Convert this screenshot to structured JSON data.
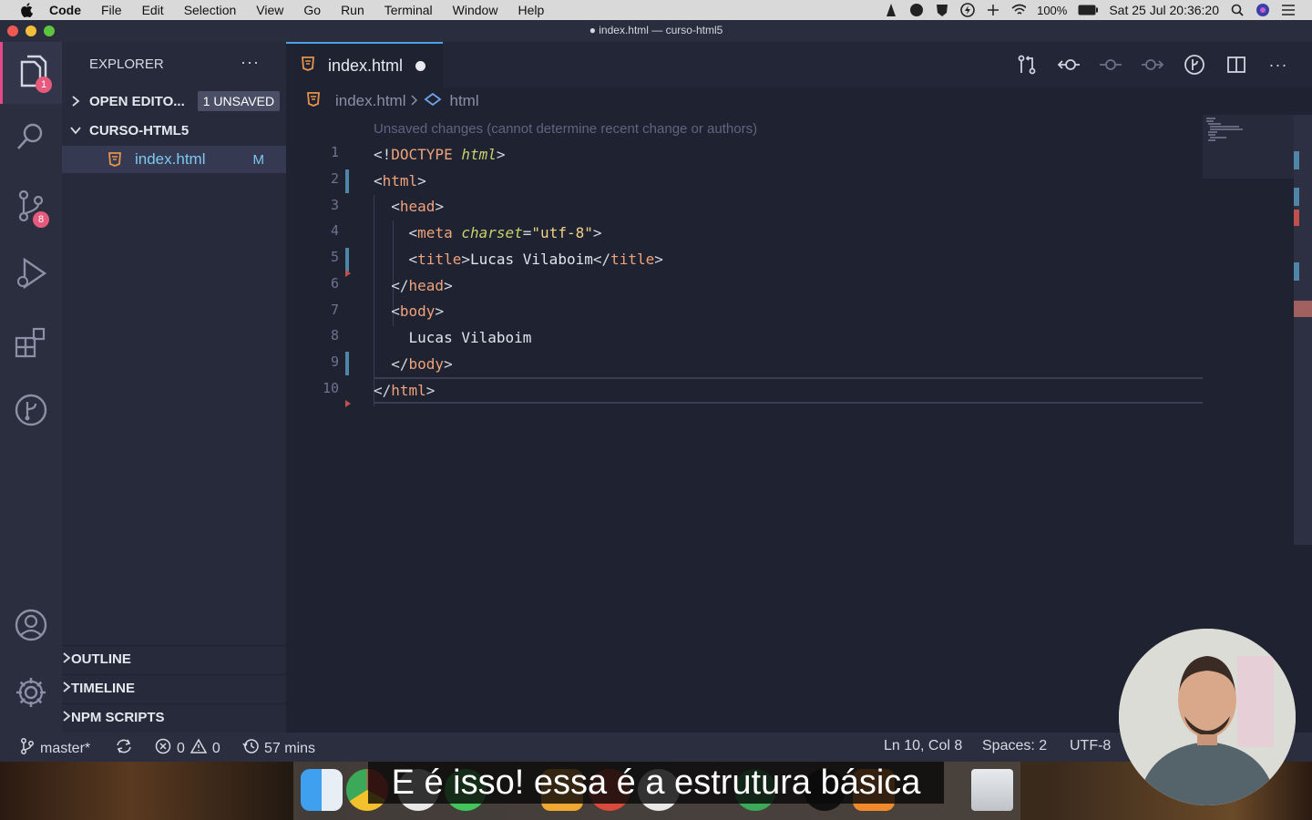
{
  "menubar": {
    "app_name": "Code",
    "items": [
      "File",
      "Edit",
      "Selection",
      "View",
      "Go",
      "Run",
      "Terminal",
      "Window",
      "Help"
    ],
    "battery": "100%",
    "datetime": "Sat 25 Jul  20:36:20"
  },
  "window": {
    "title": "● index.html — curso-html5"
  },
  "activity_bar": {
    "explorer_badge": "1",
    "scm_badge": "8"
  },
  "sidebar": {
    "title": "EXPLORER",
    "open_editors_label": "OPEN EDITO...",
    "unsaved_badge": "1 UNSAVED",
    "folder_label": "CURSO-HTML5",
    "files": [
      {
        "name": "index.html",
        "status": "M"
      }
    ],
    "outline_label": "OUTLINE",
    "timeline_label": "TIMELINE",
    "npm_label": "NPM SCRIPTS"
  },
  "tabs": [
    {
      "label": "index.html",
      "unsaved": true
    }
  ],
  "breadcrumb": {
    "file": "index.html",
    "symbol": "html"
  },
  "editor": {
    "hint": "Unsaved changes (cannot determine recent change or authors)",
    "line_numbers": [
      "1",
      "2",
      "3",
      "4",
      "5",
      "6",
      "7",
      "8",
      "9",
      "10"
    ]
  },
  "statusbar": {
    "branch": "master*",
    "errors": "0",
    "warnings": "0",
    "time": "57 mins",
    "position": "Ln 10, Col 8",
    "spaces": "Spaces: 2",
    "encoding": "UTF-8"
  },
  "subtitle": "E é isso! essa é a estrutura básica",
  "colors": {
    "accent": "#4aa3e8",
    "badge": "#e65a7e",
    "tag": "#f0a37a",
    "attribute": "#c8d26b",
    "string": "#f2d186"
  }
}
